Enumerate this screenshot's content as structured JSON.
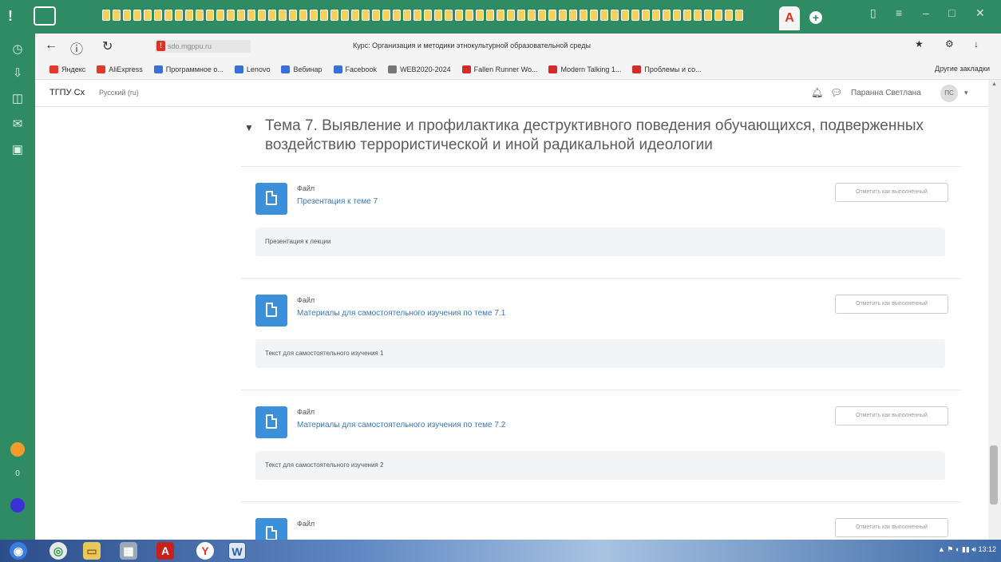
{
  "browser": {
    "page_title": "Курс: Организация и методики этнокультурной образовательной среды",
    "url_label": "sdo.mgppu.ru",
    "active_tab_letter": "A",
    "bookmarks": [
      {
        "label": "Яндекс",
        "color": "#e5382d"
      },
      {
        "label": "AliExpress",
        "color": "#e5382d"
      },
      {
        "label": "Программное о...",
        "color": "#3a6fd8"
      },
      {
        "label": "Lenovo",
        "color": "#3a6fd8"
      },
      {
        "label": "Вебинар",
        "color": "#3a6fd8"
      },
      {
        "label": "Facebook",
        "color": "#3a6fd8"
      },
      {
        "label": "WEB2020-2024",
        "color": "#777777"
      },
      {
        "label": "Fallen Runner Wo...",
        "color": "#d52b2b"
      },
      {
        "label": "Modern Talking 1...",
        "color": "#d52b2b"
      },
      {
        "label": "Проблемы и со...",
        "color": "#d52b2b"
      }
    ],
    "other_bookmarks": "Другие закладки"
  },
  "site": {
    "brand": "ТГПУ Сх",
    "menu": "Русский (ru)",
    "user": "Паранна Светлана",
    "avatar_initials": "ПС"
  },
  "section": {
    "title": "Тема 7. Выявление и профилактика деструктивного поведения обучающихся, подверженных воздействию террористической и иной радикальной идеологии"
  },
  "activities": [
    {
      "type": "Файл",
      "name": "Презентация к теме 7",
      "button": "Отметить как выполненный",
      "desc": "Презентация к лекции"
    },
    {
      "type": "Файл",
      "name": "Материалы для самостоятельного изучения по теме 7.1",
      "button": "Отметить как выполненный",
      "desc": "Текст для самостоятельного изучения 1"
    },
    {
      "type": "Файл",
      "name": "Материалы для самостоятельного изучения по теме 7.2",
      "button": "Отметить как выполненный",
      "desc": "Текст для самостоятельного изучения 2"
    },
    {
      "type": "Файл",
      "name": "",
      "button": "Отметить как выполненный",
      "desc": ""
    }
  ],
  "taskbar": {
    "apps": [
      "Windows",
      "Chrome",
      "Explorer",
      "Calculator",
      "Adobe",
      "Yandex",
      "Word"
    ],
    "clock": "13:12"
  }
}
